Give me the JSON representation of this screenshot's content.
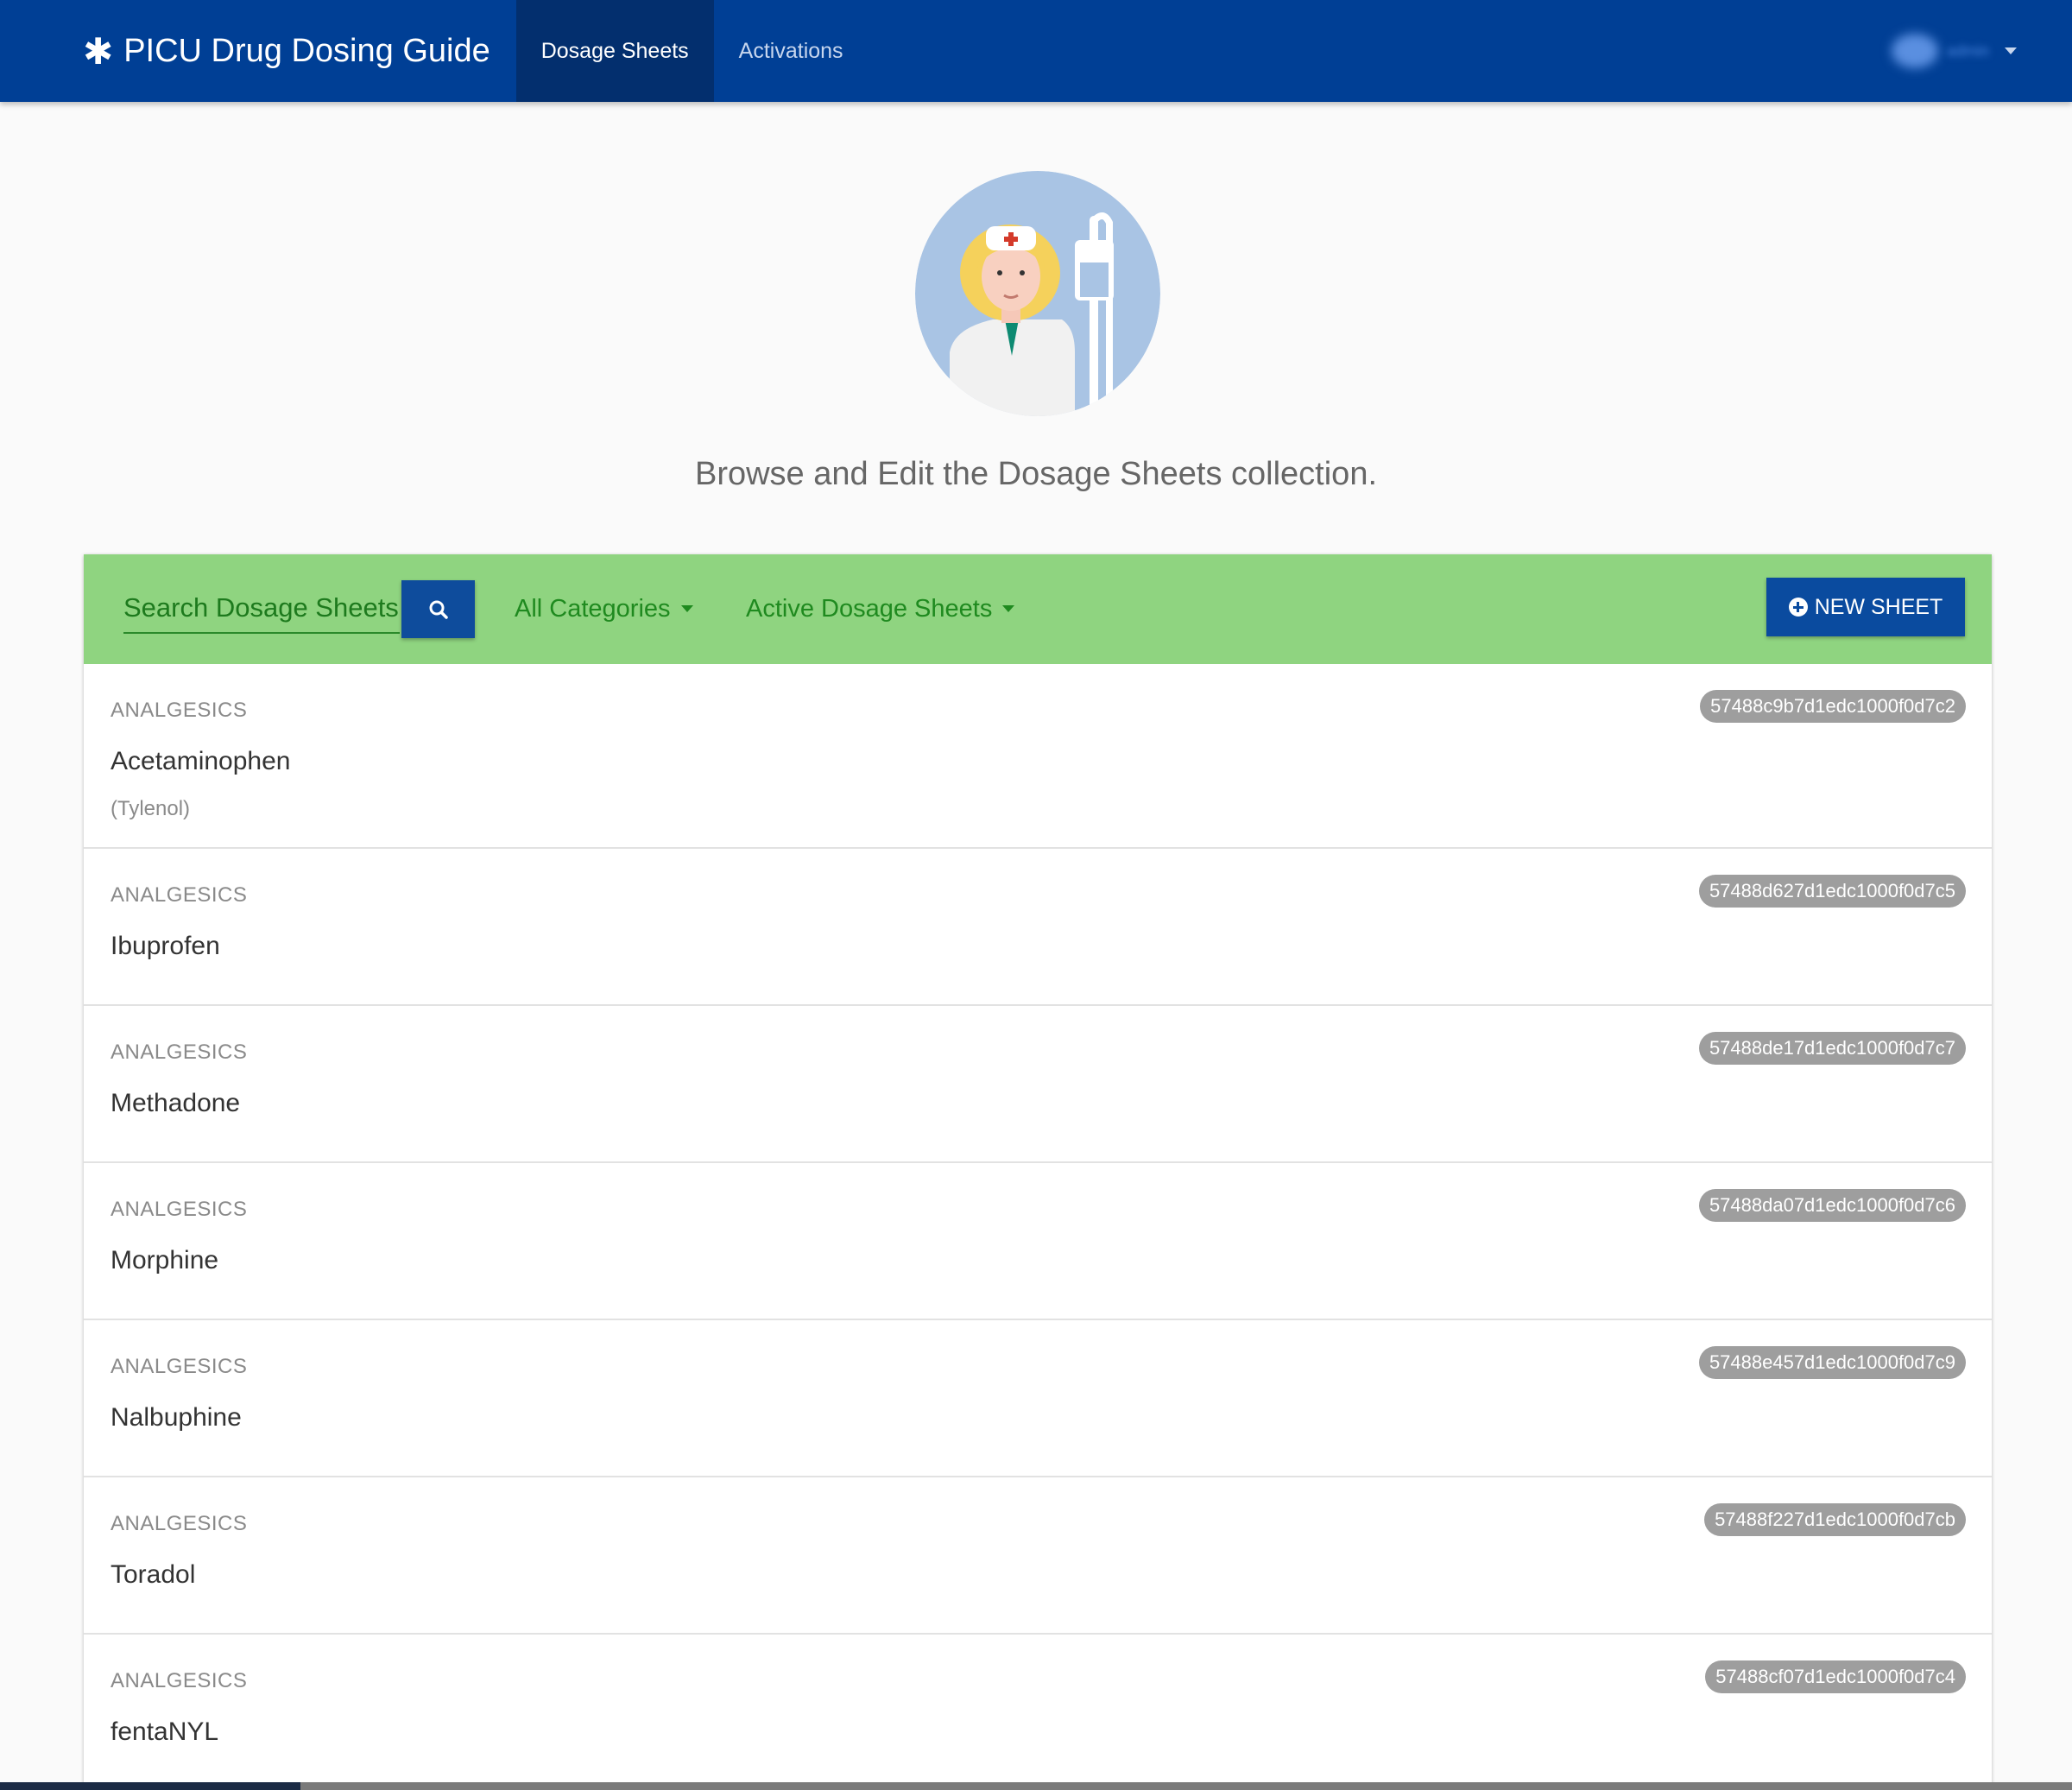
{
  "navbar": {
    "brand_icon": "asterisk-icon",
    "brand": "PICU Drug Dosing Guide",
    "tabs": [
      {
        "label": "Dosage Sheets",
        "active": true
      },
      {
        "label": "Activations",
        "active": false
      }
    ]
  },
  "hero": {
    "avatar_icon": "nurse-avatar-icon",
    "subtitle": "Browse and Edit the Dosage Sheets collection."
  },
  "toolbar": {
    "search_placeholder": "Search Dosage Sheets",
    "search_icon": "search-icon",
    "category_filter": "All Categories",
    "status_filter": "Active Dosage Sheets",
    "new_button": "NEW SHEET"
  },
  "sheets": [
    {
      "category": "ANALGESICS",
      "name": "Acetaminophen",
      "alias": "(Tylenol)",
      "id": "57488c9b7d1edc1000f0d7c2"
    },
    {
      "category": "ANALGESICS",
      "name": "Ibuprofen",
      "alias": "",
      "id": "57488d627d1edc1000f0d7c5"
    },
    {
      "category": "ANALGESICS",
      "name": "Methadone",
      "alias": "",
      "id": "57488de17d1edc1000f0d7c7"
    },
    {
      "category": "ANALGESICS",
      "name": "Morphine",
      "alias": "",
      "id": "57488da07d1edc1000f0d7c6"
    },
    {
      "category": "ANALGESICS",
      "name": "Nalbuphine",
      "alias": "",
      "id": "57488e457d1edc1000f0d7c9"
    },
    {
      "category": "ANALGESICS",
      "name": "Toradol",
      "alias": "",
      "id": "57488f227d1edc1000f0d7cb"
    },
    {
      "category": "ANALGESICS",
      "name": "fentaNYL",
      "alias": "",
      "id": "57488cf07d1edc1000f0d7c4"
    }
  ],
  "colors": {
    "navbar": "#003f95",
    "toolbar": "#8fd480",
    "primary_button": "#0a4b9f",
    "badge": "#9e9e9e"
  }
}
